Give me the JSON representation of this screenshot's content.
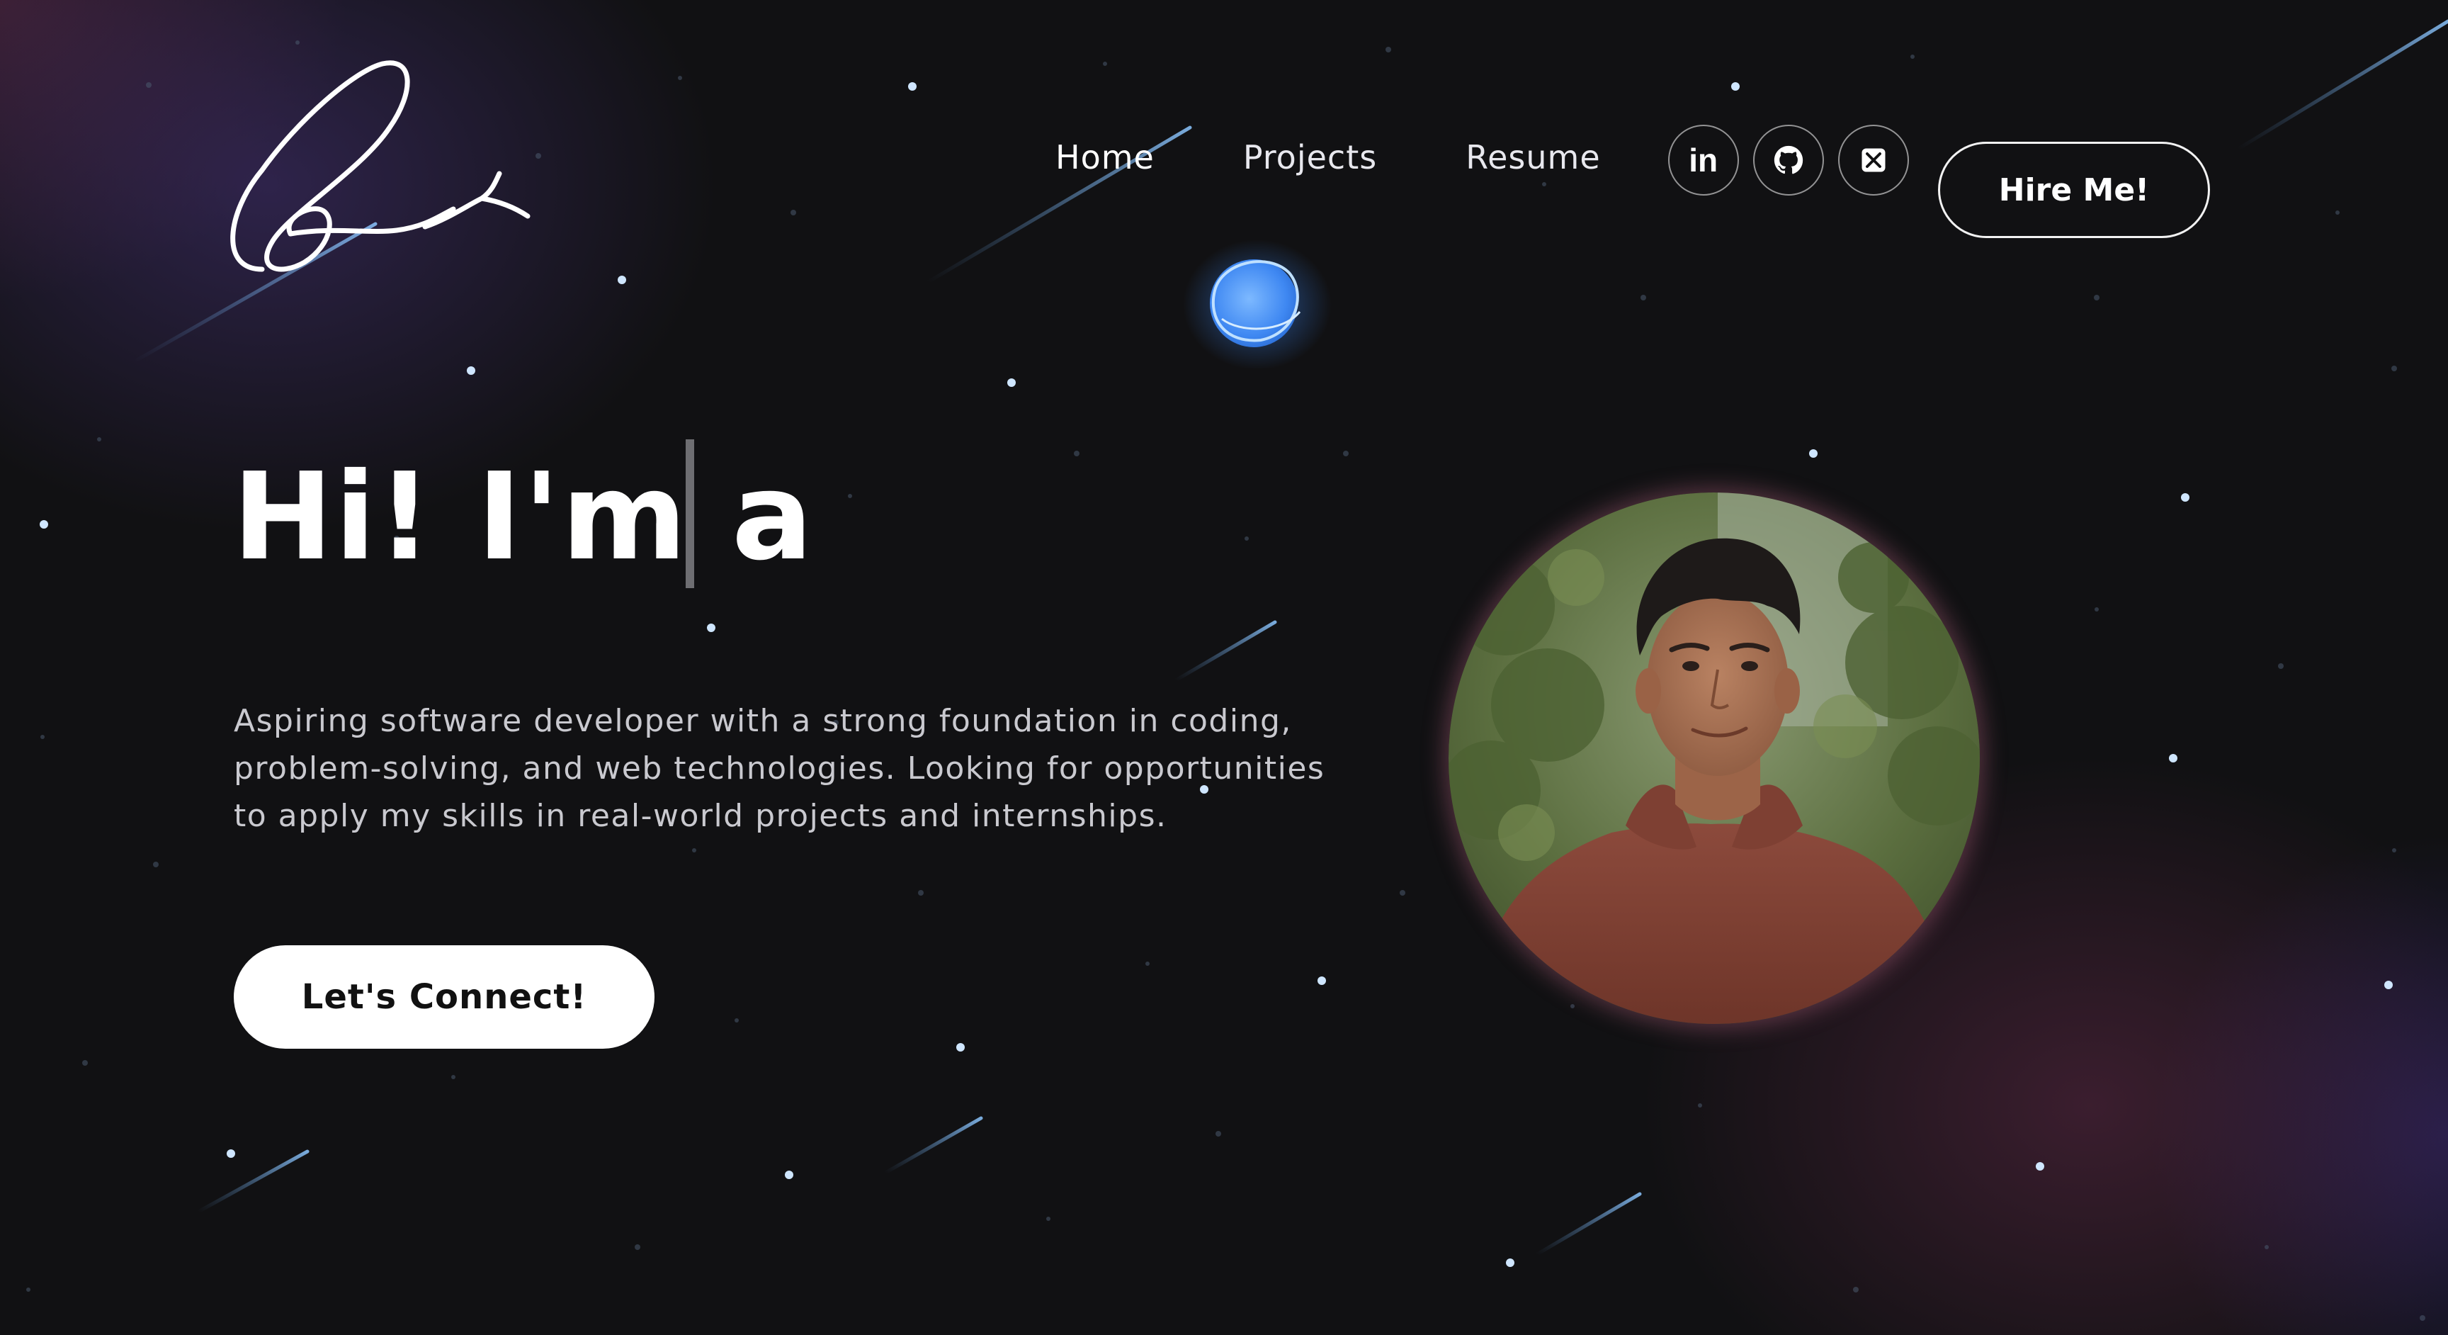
{
  "logo": {
    "alt": "signature-logo"
  },
  "nav": {
    "links": [
      "Home",
      "Projects",
      "Resume"
    ],
    "social": [
      "linkedin-icon",
      "github-icon",
      "x-icon"
    ],
    "linkedin_text": "in",
    "hire_label": "Hire Me!"
  },
  "hero": {
    "title": "Hi! I'm a",
    "description": "Aspiring software developer with a strong foundation in coding, problem-solving, and web technologies. Looking for opportunities to apply my skills in real-world projects and internships.",
    "cta_label": "Let's Connect!"
  },
  "colors": {
    "background": "#111113",
    "accent_blue": "#5aa6ff",
    "text": "#ffffff",
    "muted_text": "#c9c9cf"
  }
}
